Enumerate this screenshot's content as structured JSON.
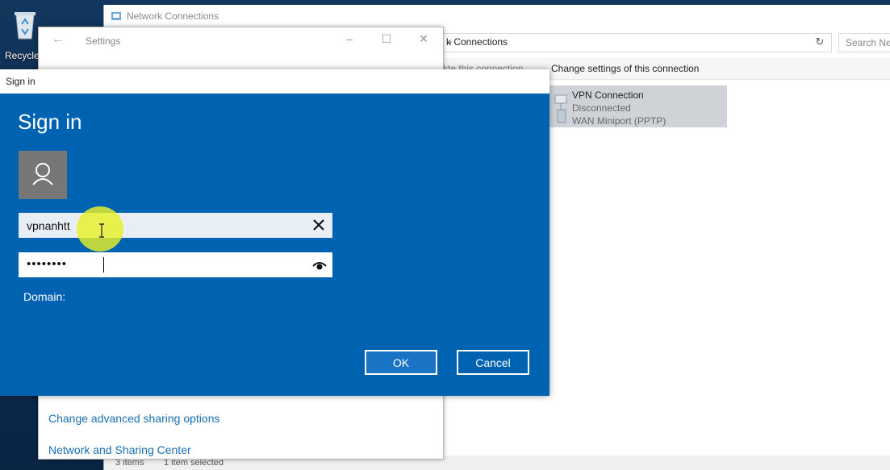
{
  "desktop": {
    "recycle_label": "Recycle"
  },
  "network_window": {
    "title": "Network Connections",
    "address": "k Connections",
    "search_placeholder": "Search Net",
    "cmd_partial": "kte this connection",
    "cmd_change": "Change settings of this connection",
    "vpn": {
      "name": "VPN Connection",
      "status": "Disconnected",
      "device": "WAN Miniport (PPTP)"
    },
    "status_items": "3 items",
    "status_selected": "1 item selected"
  },
  "settings_window": {
    "title": "Settings",
    "link_sharing": "Change advanced sharing options",
    "link_center": "Network and Sharing Center"
  },
  "signin_dialog": {
    "header": "Sign in",
    "heading": "Sign in",
    "username": "vpnanhtt",
    "password_mask": "••••••••",
    "domain_label": "Domain:",
    "ok_label": "OK",
    "cancel_label": "Cancel"
  },
  "colors": {
    "accent": "#0063b1",
    "highlight": "#e8f028"
  }
}
